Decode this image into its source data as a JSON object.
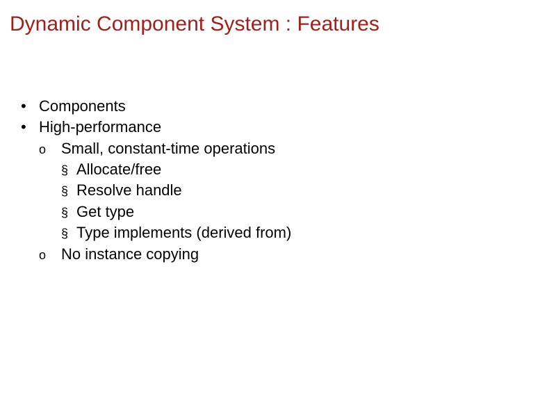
{
  "title": "Dynamic Component System : Features",
  "bullets": {
    "components": "Components",
    "high_performance": "High-performance",
    "small_ops": "Small, constant-time operations",
    "allocate_free": "Allocate/free",
    "resolve_handle": "Resolve handle",
    "get_type": "Get type",
    "type_implements": "Type implements (derived from)",
    "no_instance_copying": "No instance copying"
  },
  "markers": {
    "dot": "•",
    "circle": "o",
    "square": "§"
  }
}
